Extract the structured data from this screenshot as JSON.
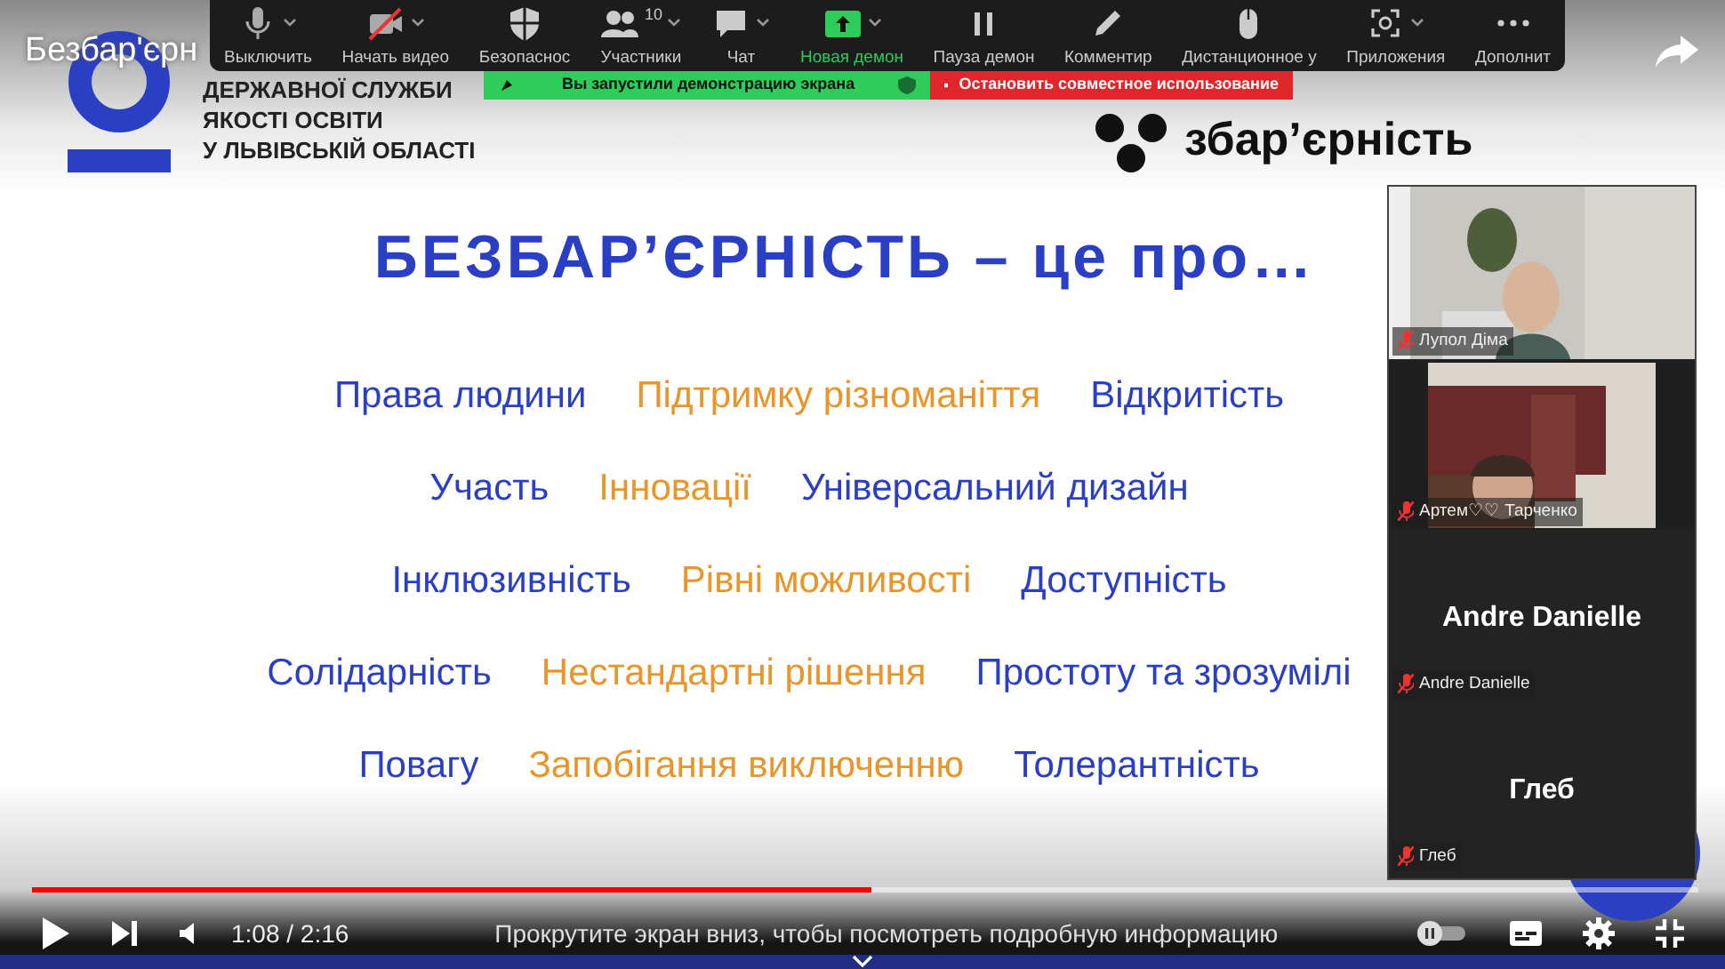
{
  "video_title": "Безбар'єрн",
  "slide": {
    "org_lines": [
      "ДЕРЖАВНОЇ СЛУЖБИ",
      "ЯКОСТІ ОСВІТИ",
      "У ЛЬВІВСЬКІЙ ОБЛАСТІ"
    ],
    "brand": "збар’єрність",
    "heading": "БЕЗБАР’ЄРНІСТЬ – це про…",
    "rows": [
      [
        {
          "text": "Права людини",
          "color": "#2b3fc4"
        },
        {
          "text": "Підтримку різноманіття",
          "color": "#e8952a"
        },
        {
          "text": "Відкритість",
          "color": "#2b3fc4"
        }
      ],
      [
        {
          "text": "Участь",
          "color": "#2b3fc4"
        },
        {
          "text": "Інновації",
          "color": "#e8952a"
        },
        {
          "text": "Універсальний дизайн",
          "color": "#2b3fc4"
        }
      ],
      [
        {
          "text": "Інклюзивність",
          "color": "#2b3fc4"
        },
        {
          "text": "Рівні можливості",
          "color": "#e8952a"
        },
        {
          "text": "Доступність",
          "color": "#2b3fc4"
        }
      ],
      [
        {
          "text": "Солідарність",
          "color": "#2b3fc4"
        },
        {
          "text": "Нестандартні рішення",
          "color": "#e8952a"
        },
        {
          "text": "Простоту та зрозумілі",
          "color": "#2b3fc4"
        }
      ],
      [
        {
          "text": "Повагу",
          "color": "#2b3fc4"
        },
        {
          "text": "Запобігання виключенню",
          "color": "#e8952a"
        },
        {
          "text": "Толерантність",
          "color": "#2b3fc4"
        }
      ]
    ]
  },
  "zoom_toolbar": [
    {
      "kind": "mic",
      "label": "Выключить",
      "caret": true,
      "highlighted": false
    },
    {
      "kind": "camera-off",
      "label": "Начать видео",
      "caret": true,
      "highlighted": false
    },
    {
      "kind": "shield",
      "label": "Безопаснос",
      "caret": false,
      "highlighted": false
    },
    {
      "kind": "people",
      "label": "Участники",
      "count": "10",
      "caret": true,
      "highlighted": false
    },
    {
      "kind": "chat",
      "label": "Чат",
      "caret": true,
      "highlighted": false
    },
    {
      "kind": "share",
      "label": "Новая демон",
      "caret": true,
      "highlighted": true
    },
    {
      "kind": "pause",
      "label": "Пауза демон",
      "caret": false,
      "highlighted": false
    },
    {
      "kind": "pencil",
      "label": "Комментир",
      "caret": false,
      "highlighted": false
    },
    {
      "kind": "mouse",
      "label": "Дистанционное у",
      "caret": false,
      "highlighted": false
    },
    {
      "kind": "apps",
      "label": "Приложения",
      "caret": true,
      "highlighted": false
    },
    {
      "kind": "more",
      "label": "Дополнит",
      "caret": false,
      "highlighted": false
    }
  ],
  "share_banner": {
    "status": "Вы запустили демонстрацию экрана",
    "stop": "Остановить совместное использование"
  },
  "participants": [
    {
      "kind": "video",
      "name": "Лупол Діма",
      "muted": true
    },
    {
      "kind": "video",
      "name": "Артем♡♡ Тарченко",
      "muted": true
    },
    {
      "kind": "name",
      "display": "Andre Danielle",
      "name": "Andre Danielle",
      "muted": true
    },
    {
      "kind": "name",
      "display": "Глеб",
      "name": "Глеб",
      "muted": true
    }
  ],
  "player": {
    "progress": {
      "level": 0.504
    },
    "time": "1:08 / 2:16",
    "hint": "Прокрутите экран вниз, чтобы посмотреть подробную информацию",
    "autoplay": false
  }
}
